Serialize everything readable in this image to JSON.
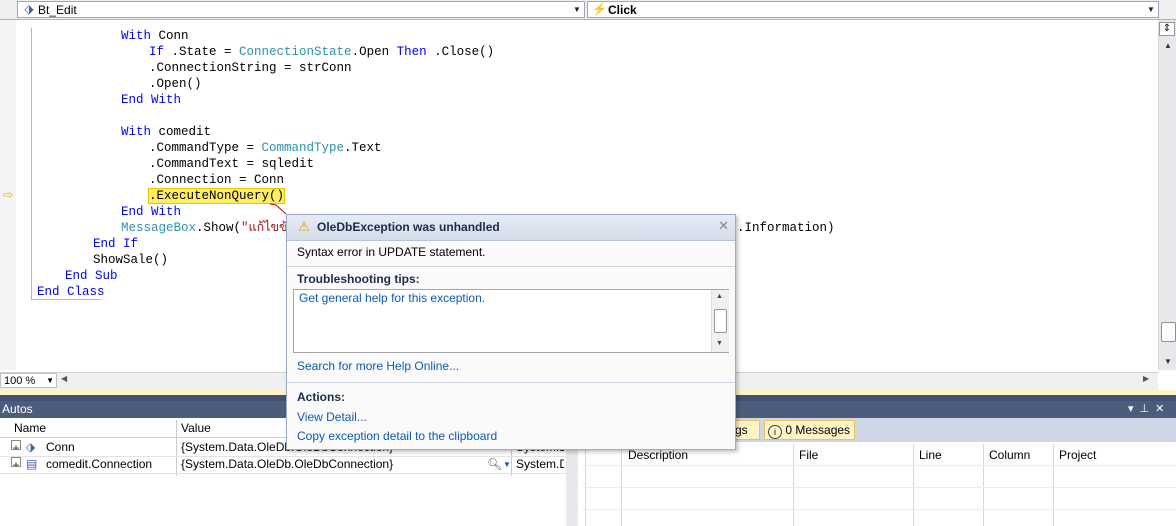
{
  "navbar": {
    "class_combo": "Bt_Edit",
    "method_combo": "Click"
  },
  "code_lines": [
    [
      "With",
      " Conn"
    ],
    [
      "If",
      " .State = ",
      "ConnectionState",
      ".Open ",
      "Then",
      " .Close()"
    ],
    [
      ".ConnectionString = strConn"
    ],
    [
      ".Open()"
    ],
    [
      "End With"
    ],
    [
      "With",
      " comedit"
    ],
    [
      ".CommandType = ",
      "CommandType",
      ".Text"
    ],
    [
      ".CommandText = sqledit"
    ],
    [
      ".Connection = Conn"
    ],
    [
      ".ExecuteNonQuery()"
    ],
    [
      "End With"
    ],
    [
      "MessageBox",
      ".Show(",
      "\"แก้ไขข้อมู",
      ".Information)"
    ],
    [
      "End If"
    ],
    [
      "ShowSale()"
    ],
    [
      "End Sub"
    ],
    [
      "End Class"
    ]
  ],
  "code": {
    "l1_kw": "With",
    "l1_rest": " Conn",
    "l2_kw1": "If",
    "l2_a": " .State = ",
    "l2_ty": "ConnectionState",
    "l2_b": ".Open ",
    "l2_kw2": "Then",
    "l2_c": " .Close()",
    "l3": ".ConnectionString = strConn",
    "l4": ".Open()",
    "l5": "End With",
    "l6_kw": "With",
    "l6_rest": " comedit",
    "l7_a": ".CommandType = ",
    "l7_ty": "CommandType",
    "l7_b": ".Text",
    "l8": ".CommandText = sqledit",
    "l9": ".Connection = Conn",
    "l10": ".ExecuteNonQuery()",
    "l11": "End With",
    "l12_ty": "MessageBox",
    "l12_a": ".Show(",
    "l12_str": "\"แก้ไขข้อมู",
    "l12_tail": ".Information)",
    "l13": "End If",
    "l14": "ShowSale()",
    "l15": "End Sub",
    "l16": "End Class"
  },
  "zoom": "100 %",
  "autos": {
    "title": "Autos",
    "headers": {
      "name": "Name",
      "value": "Value"
    },
    "rows": [
      {
        "name": "Conn",
        "value": "{System.Data.OleDb.OleDbConnection}",
        "type": "System.D"
      },
      {
        "name": "comedit.Connection",
        "value": "{System.Data.OleDb.OleDbConnection}",
        "type": "System.D"
      }
    ]
  },
  "error_list": {
    "warnings_partial": "gs",
    "messages": "0 Messages",
    "headers": {
      "description": "Description",
      "file": "File",
      "line": "Line",
      "column": "Column",
      "project": "Project"
    }
  },
  "exception": {
    "title": "OleDbException was unhandled",
    "message": "Syntax error in UPDATE statement.",
    "tips_heading": "Troubleshooting tips:",
    "tip_link": "Get general help for this exception.",
    "search_link": "Search for more Help Online...",
    "actions_heading": "Actions:",
    "view_detail": "View Detail...",
    "copy_detail": "Copy exception detail to the clipboard"
  },
  "icons": {
    "exec_arrow": "current-statement-arrow-icon",
    "warning": "warning-triangle-icon",
    "close": "close-icon"
  },
  "colors": {
    "keyword": "#0000ff",
    "type": "#2b91af",
    "string": "#a31515",
    "highlight": "#ffee62",
    "panel_title": "#4c5d7c"
  }
}
